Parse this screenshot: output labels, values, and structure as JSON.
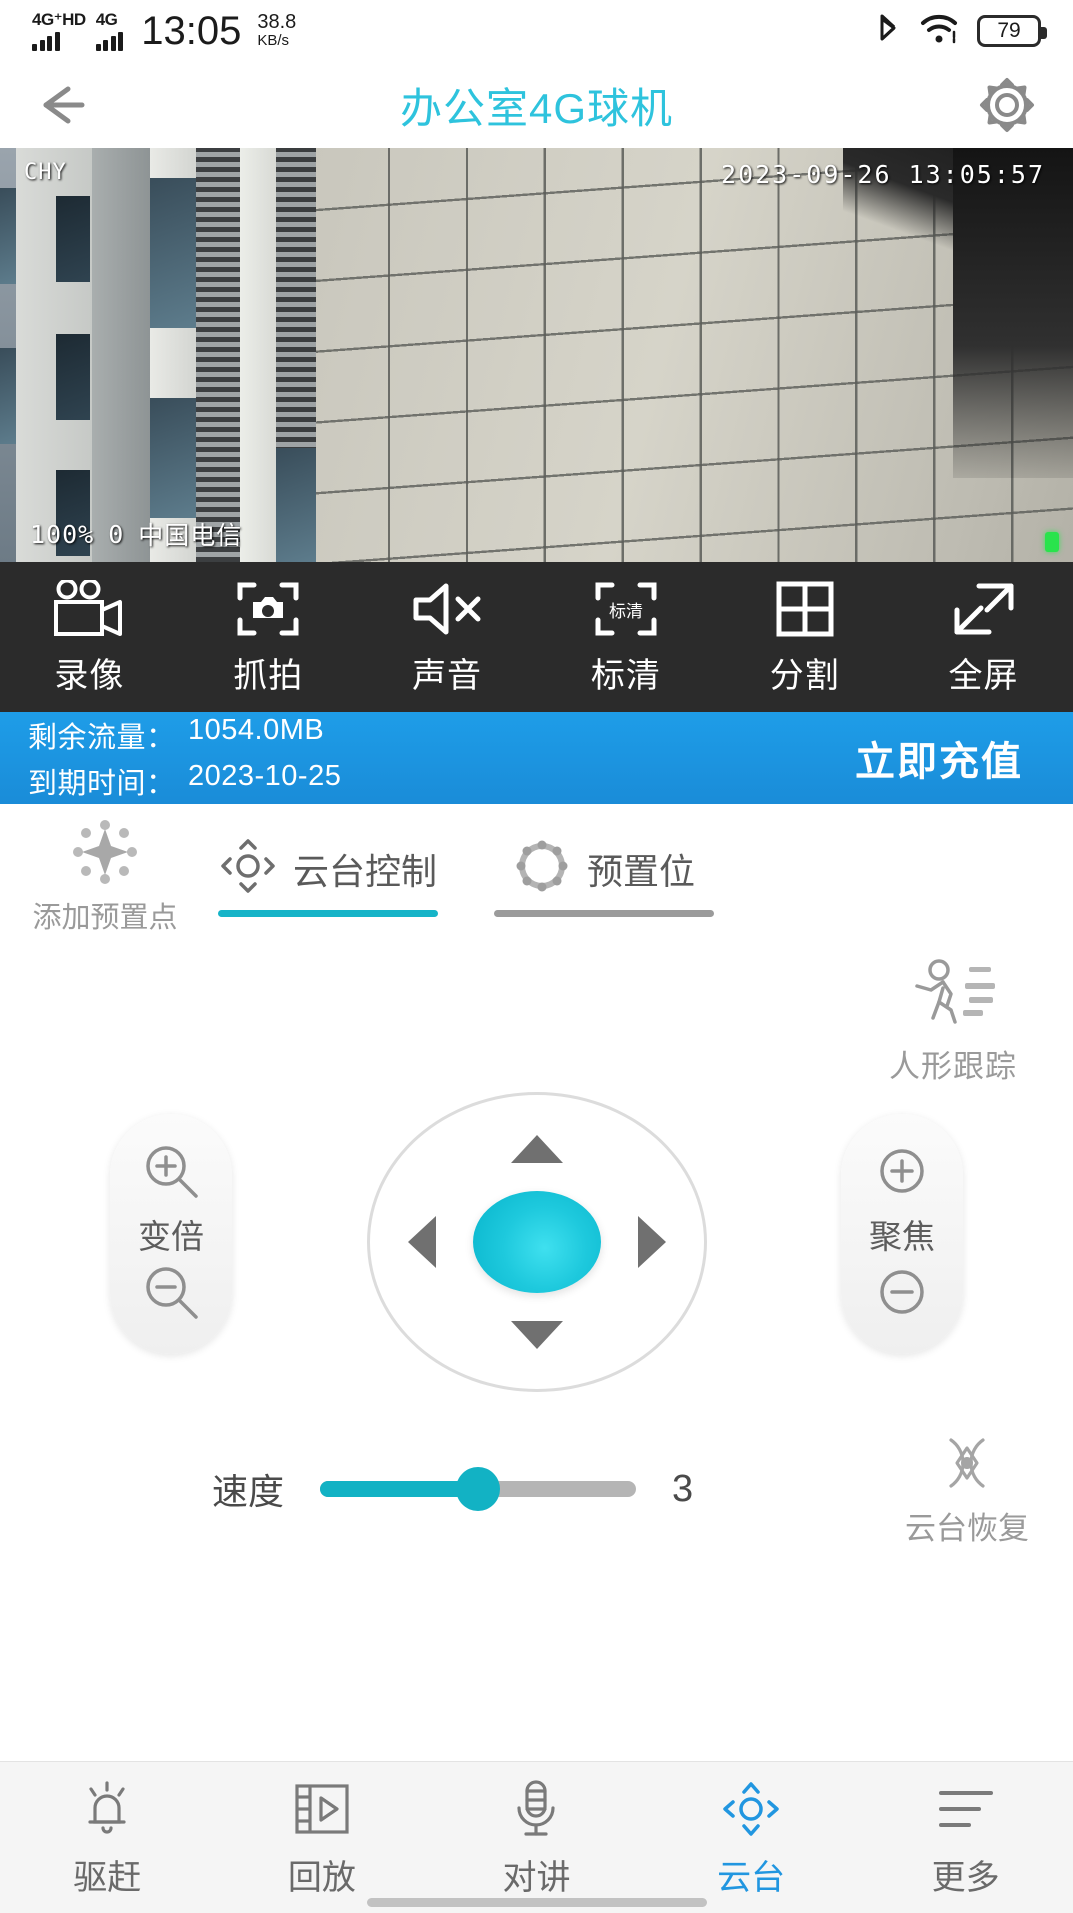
{
  "statusbar": {
    "net_tag_1": "4G⁺HD",
    "net_tag_2": "4G",
    "time": "13:05",
    "speed_value": "38.8",
    "speed_unit": "KB/s",
    "bluetooth_icon": "bluetooth-icon",
    "wifi_icon": "wifi-icon",
    "battery_level": "79"
  },
  "titlebar": {
    "back_icon": "back-arrow-icon",
    "title": "办公室4G球机",
    "settings_icon": "gear-icon",
    "accent": "#2ec3dd"
  },
  "video": {
    "channel_tag": "CHY",
    "timestamp": "2023-09-26  13:05:57",
    "signal_percent": "100%",
    "signal_bars": "0",
    "carrier": "中国电信",
    "recording_dot": "green-status-dot"
  },
  "toolbar": {
    "items": [
      {
        "icon": "camcorder-icon",
        "label": "录像"
      },
      {
        "icon": "snapshot-icon",
        "label": "抓拍"
      },
      {
        "icon": "sound-muted-icon",
        "label": "声音"
      },
      {
        "icon": "quality-icon",
        "label": "标清"
      },
      {
        "icon": "split-grid-icon",
        "label": "分割"
      },
      {
        "icon": "fullscreen-icon",
        "label": "全屏"
      }
    ],
    "quality_badge": "标清",
    "background": "#2b2b2b"
  },
  "banner": {
    "traffic_key": "剩余流量：",
    "traffic_value": "1054.0MB",
    "expiry_key": "到期时间：",
    "expiry_value": "2023-10-25",
    "cta": "立即充值",
    "background": "#1e9de8"
  },
  "tabs": {
    "add_preset": {
      "icon": "add-preset-star-icon",
      "label": "添加预置点"
    },
    "items": [
      {
        "icon": "ptz-control-icon",
        "label": "云台控制",
        "active": true
      },
      {
        "icon": "preset-circle-icon",
        "label": "预置位",
        "active": false
      }
    ],
    "active_color": "#16b4c8",
    "idle_color": "#9b9b9b"
  },
  "ptz": {
    "human_tracking": {
      "icon": "running-person-icon",
      "label": "人形跟踪"
    },
    "zoom_pill": {
      "plus_icon": "zoom-in-icon",
      "label": "变倍",
      "minus_icon": "zoom-out-icon"
    },
    "focus_pill": {
      "plus_icon": "focus-in-icon",
      "label": "聚焦",
      "minus_icon": "focus-out-icon"
    },
    "dpad": {
      "up_icon": "arrow-up-icon",
      "down_icon": "arrow-down-icon",
      "left_icon": "arrow-left-icon",
      "right_icon": "arrow-right-icon",
      "center": "joystick-knob",
      "knob_color": "#1ec9dd"
    },
    "speed": {
      "label": "速度",
      "value": "3",
      "min": 1,
      "max": 6,
      "percent": 50,
      "fill_color": "#12b2c4"
    },
    "restore": {
      "icon": "ptz-restore-icon",
      "label": "云台恢复"
    }
  },
  "bottomnav": {
    "items": [
      {
        "icon": "siren-bell-icon",
        "label": "驱赶",
        "active": false
      },
      {
        "icon": "playback-film-icon",
        "label": "回放",
        "active": false
      },
      {
        "icon": "intercom-mic-icon",
        "label": "对讲",
        "active": false
      },
      {
        "icon": "ptz-diamond-icon",
        "label": "云台",
        "active": true
      },
      {
        "icon": "more-lines-icon",
        "label": "更多",
        "active": false
      }
    ],
    "active_color": "#2196e0"
  }
}
